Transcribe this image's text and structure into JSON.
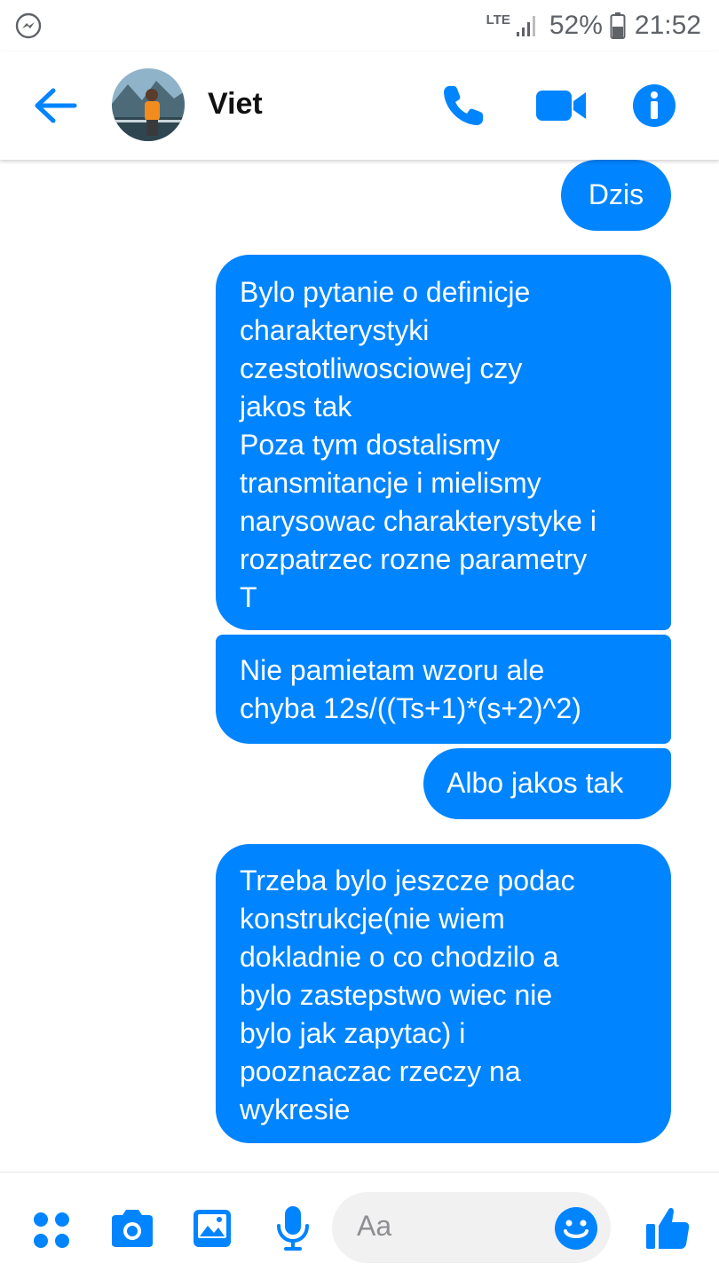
{
  "status_bar": {
    "network": "LTE",
    "battery_percent": "52%",
    "time": "21:52",
    "battery_level": 0.52,
    "icons": [
      "messenger-notification-icon",
      "signal-icon",
      "battery-icon"
    ]
  },
  "header": {
    "contact_name": "Viet",
    "icons": [
      "back-arrow-icon",
      "phone-icon",
      "video-camera-icon",
      "info-icon"
    ]
  },
  "messages": [
    {
      "sender": "me",
      "text": "Dzis"
    },
    {
      "sender": "me",
      "text": "Bylo pytanie o definicje\ncharakterystyki\nczestotliwosciowej czy\njakos tak\nPoza tym dostalismy\ntransmitancje i mielismy\nnarysowac charakterystyke i\nrozpatrzec rozne parametry\nT"
    },
    {
      "sender": "me",
      "text": "Nie pamietam wzoru ale\nchyba 12s/((Ts+1)*(s+2)^2)"
    },
    {
      "sender": "me",
      "text": "Albo jakos tak"
    },
    {
      "sender": "me",
      "text": "Trzeba bylo jeszcze podac\nkonstrukcje(nie wiem\ndokladnie o co chodzilo a\nbylo zastepstwo wiec nie\nbylo jak zapytac) i\npooznaczac rzeczy na\nwykresie"
    }
  ],
  "composer": {
    "placeholder": "Aa",
    "icons": [
      "apps-icon",
      "camera-icon",
      "gallery-icon",
      "microphone-icon",
      "emoji-icon",
      "thumbs-up-icon"
    ]
  },
  "colors": {
    "accent": "#0084ff",
    "bubble_text": "#ffffff",
    "status_text": "#5f6368"
  }
}
